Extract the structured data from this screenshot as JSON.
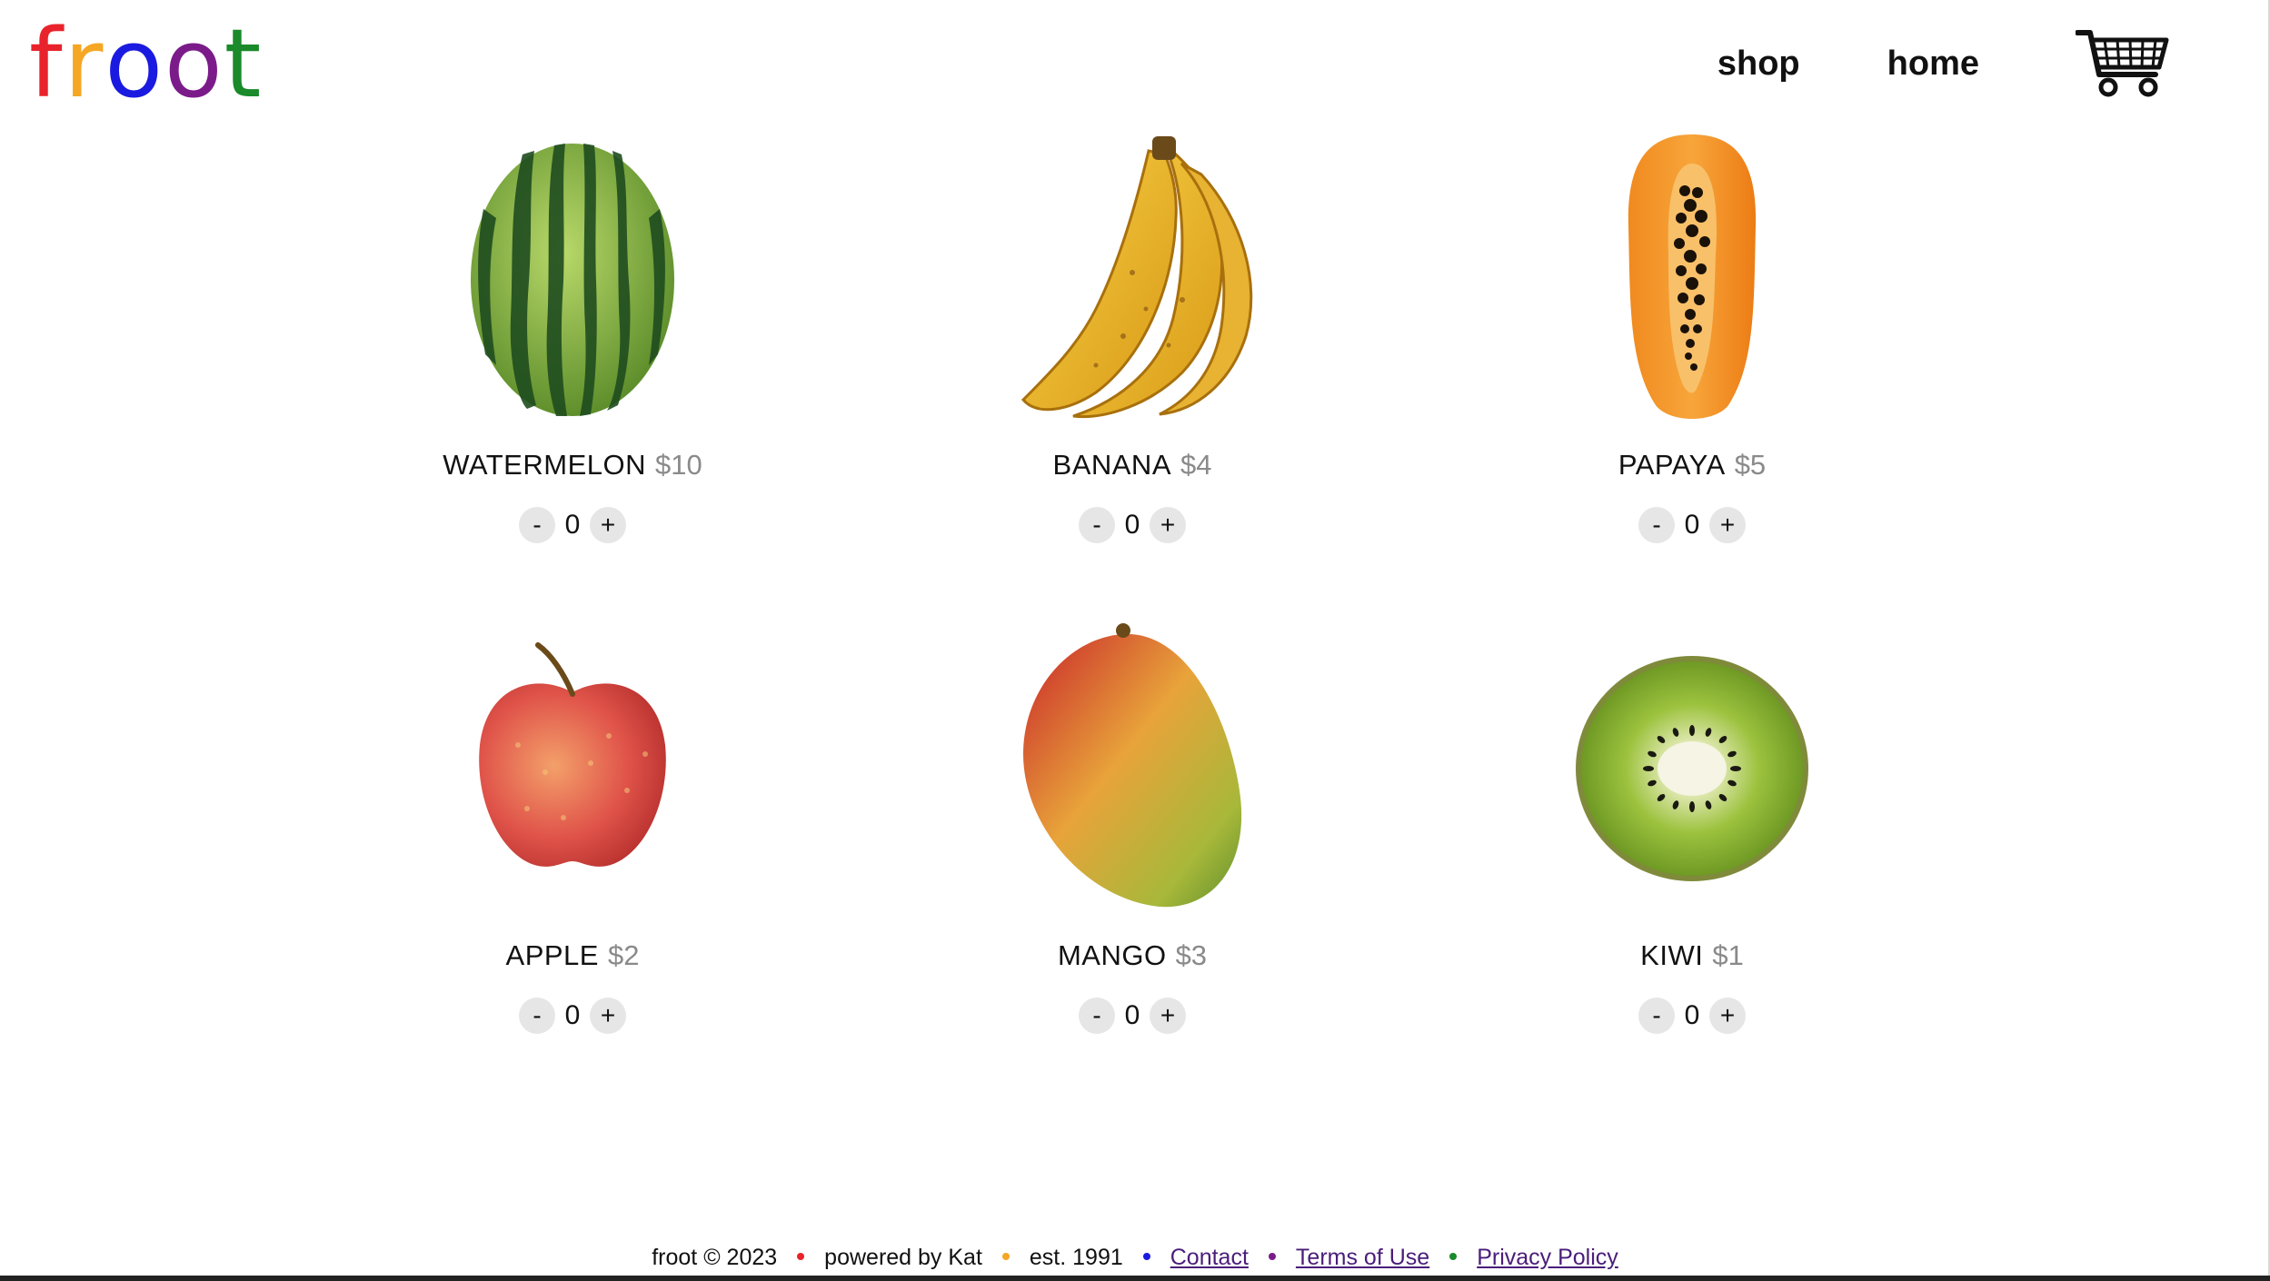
{
  "logo": {
    "letters": [
      {
        "char": "f",
        "color": "#e8232b"
      },
      {
        "char": "r",
        "color": "#f5a623"
      },
      {
        "char": "o",
        "color": "#1a1ae0"
      },
      {
        "char": "o",
        "color": "#7b1b8a"
      },
      {
        "char": "t",
        "color": "#1a8a2a"
      }
    ]
  },
  "nav": {
    "shop_label": "shop",
    "home_label": "home",
    "cart_icon": "shopping-cart-icon"
  },
  "products": [
    {
      "name": "WATERMELON",
      "price": "$10",
      "qty": "0",
      "icon": "watermelon-icon"
    },
    {
      "name": "BANANA",
      "price": "$4",
      "qty": "0",
      "icon": "banana-icon"
    },
    {
      "name": "PAPAYA",
      "price": "$5",
      "qty": "0",
      "icon": "papaya-icon"
    },
    {
      "name": "APPLE",
      "price": "$2",
      "qty": "0",
      "icon": "apple-icon"
    },
    {
      "name": "MANGO",
      "price": "$3",
      "qty": "0",
      "icon": "mango-icon"
    },
    {
      "name": "KIWI",
      "price": "$1",
      "qty": "0",
      "icon": "kiwi-icon"
    }
  ],
  "stepper": {
    "minus": "-",
    "plus": "+"
  },
  "footer": {
    "copyright": "froot © 2023",
    "powered": "powered by Kat",
    "established": "est. 1991",
    "contact": "Contact",
    "terms": "Terms of Use",
    "privacy": "Privacy Policy",
    "dot_colors": [
      "#e8232b",
      "#f5a623",
      "#1a1ae0",
      "#7b1b8a",
      "#1a8a2a"
    ],
    "link_color": "#4a1d7a"
  }
}
